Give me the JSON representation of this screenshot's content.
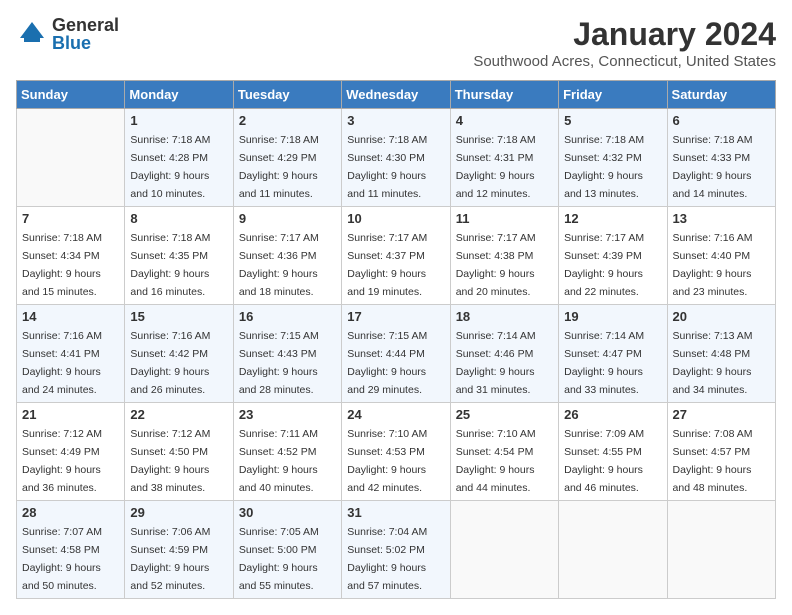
{
  "logo": {
    "general": "General",
    "blue": "Blue"
  },
  "header": {
    "title": "January 2024",
    "subtitle": "Southwood Acres, Connecticut, United States"
  },
  "weekdays": [
    "Sunday",
    "Monday",
    "Tuesday",
    "Wednesday",
    "Thursday",
    "Friday",
    "Saturday"
  ],
  "weeks": [
    [
      {
        "day": "",
        "sunrise": "",
        "sunset": "",
        "daylight": ""
      },
      {
        "day": "1",
        "sunrise": "Sunrise: 7:18 AM",
        "sunset": "Sunset: 4:28 PM",
        "daylight": "Daylight: 9 hours and 10 minutes."
      },
      {
        "day": "2",
        "sunrise": "Sunrise: 7:18 AM",
        "sunset": "Sunset: 4:29 PM",
        "daylight": "Daylight: 9 hours and 11 minutes."
      },
      {
        "day": "3",
        "sunrise": "Sunrise: 7:18 AM",
        "sunset": "Sunset: 4:30 PM",
        "daylight": "Daylight: 9 hours and 11 minutes."
      },
      {
        "day": "4",
        "sunrise": "Sunrise: 7:18 AM",
        "sunset": "Sunset: 4:31 PM",
        "daylight": "Daylight: 9 hours and 12 minutes."
      },
      {
        "day": "5",
        "sunrise": "Sunrise: 7:18 AM",
        "sunset": "Sunset: 4:32 PM",
        "daylight": "Daylight: 9 hours and 13 minutes."
      },
      {
        "day": "6",
        "sunrise": "Sunrise: 7:18 AM",
        "sunset": "Sunset: 4:33 PM",
        "daylight": "Daylight: 9 hours and 14 minutes."
      }
    ],
    [
      {
        "day": "7",
        "sunrise": "Sunrise: 7:18 AM",
        "sunset": "Sunset: 4:34 PM",
        "daylight": "Daylight: 9 hours and 15 minutes."
      },
      {
        "day": "8",
        "sunrise": "Sunrise: 7:18 AM",
        "sunset": "Sunset: 4:35 PM",
        "daylight": "Daylight: 9 hours and 16 minutes."
      },
      {
        "day": "9",
        "sunrise": "Sunrise: 7:17 AM",
        "sunset": "Sunset: 4:36 PM",
        "daylight": "Daylight: 9 hours and 18 minutes."
      },
      {
        "day": "10",
        "sunrise": "Sunrise: 7:17 AM",
        "sunset": "Sunset: 4:37 PM",
        "daylight": "Daylight: 9 hours and 19 minutes."
      },
      {
        "day": "11",
        "sunrise": "Sunrise: 7:17 AM",
        "sunset": "Sunset: 4:38 PM",
        "daylight": "Daylight: 9 hours and 20 minutes."
      },
      {
        "day": "12",
        "sunrise": "Sunrise: 7:17 AM",
        "sunset": "Sunset: 4:39 PM",
        "daylight": "Daylight: 9 hours and 22 minutes."
      },
      {
        "day": "13",
        "sunrise": "Sunrise: 7:16 AM",
        "sunset": "Sunset: 4:40 PM",
        "daylight": "Daylight: 9 hours and 23 minutes."
      }
    ],
    [
      {
        "day": "14",
        "sunrise": "Sunrise: 7:16 AM",
        "sunset": "Sunset: 4:41 PM",
        "daylight": "Daylight: 9 hours and 24 minutes."
      },
      {
        "day": "15",
        "sunrise": "Sunrise: 7:16 AM",
        "sunset": "Sunset: 4:42 PM",
        "daylight": "Daylight: 9 hours and 26 minutes."
      },
      {
        "day": "16",
        "sunrise": "Sunrise: 7:15 AM",
        "sunset": "Sunset: 4:43 PM",
        "daylight": "Daylight: 9 hours and 28 minutes."
      },
      {
        "day": "17",
        "sunrise": "Sunrise: 7:15 AM",
        "sunset": "Sunset: 4:44 PM",
        "daylight": "Daylight: 9 hours and 29 minutes."
      },
      {
        "day": "18",
        "sunrise": "Sunrise: 7:14 AM",
        "sunset": "Sunset: 4:46 PM",
        "daylight": "Daylight: 9 hours and 31 minutes."
      },
      {
        "day": "19",
        "sunrise": "Sunrise: 7:14 AM",
        "sunset": "Sunset: 4:47 PM",
        "daylight": "Daylight: 9 hours and 33 minutes."
      },
      {
        "day": "20",
        "sunrise": "Sunrise: 7:13 AM",
        "sunset": "Sunset: 4:48 PM",
        "daylight": "Daylight: 9 hours and 34 minutes."
      }
    ],
    [
      {
        "day": "21",
        "sunrise": "Sunrise: 7:12 AM",
        "sunset": "Sunset: 4:49 PM",
        "daylight": "Daylight: 9 hours and 36 minutes."
      },
      {
        "day": "22",
        "sunrise": "Sunrise: 7:12 AM",
        "sunset": "Sunset: 4:50 PM",
        "daylight": "Daylight: 9 hours and 38 minutes."
      },
      {
        "day": "23",
        "sunrise": "Sunrise: 7:11 AM",
        "sunset": "Sunset: 4:52 PM",
        "daylight": "Daylight: 9 hours and 40 minutes."
      },
      {
        "day": "24",
        "sunrise": "Sunrise: 7:10 AM",
        "sunset": "Sunset: 4:53 PM",
        "daylight": "Daylight: 9 hours and 42 minutes."
      },
      {
        "day": "25",
        "sunrise": "Sunrise: 7:10 AM",
        "sunset": "Sunset: 4:54 PM",
        "daylight": "Daylight: 9 hours and 44 minutes."
      },
      {
        "day": "26",
        "sunrise": "Sunrise: 7:09 AM",
        "sunset": "Sunset: 4:55 PM",
        "daylight": "Daylight: 9 hours and 46 minutes."
      },
      {
        "day": "27",
        "sunrise": "Sunrise: 7:08 AM",
        "sunset": "Sunset: 4:57 PM",
        "daylight": "Daylight: 9 hours and 48 minutes."
      }
    ],
    [
      {
        "day": "28",
        "sunrise": "Sunrise: 7:07 AM",
        "sunset": "Sunset: 4:58 PM",
        "daylight": "Daylight: 9 hours and 50 minutes."
      },
      {
        "day": "29",
        "sunrise": "Sunrise: 7:06 AM",
        "sunset": "Sunset: 4:59 PM",
        "daylight": "Daylight: 9 hours and 52 minutes."
      },
      {
        "day": "30",
        "sunrise": "Sunrise: 7:05 AM",
        "sunset": "Sunset: 5:00 PM",
        "daylight": "Daylight: 9 hours and 55 minutes."
      },
      {
        "day": "31",
        "sunrise": "Sunrise: 7:04 AM",
        "sunset": "Sunset: 5:02 PM",
        "daylight": "Daylight: 9 hours and 57 minutes."
      },
      {
        "day": "",
        "sunrise": "",
        "sunset": "",
        "daylight": ""
      },
      {
        "day": "",
        "sunrise": "",
        "sunset": "",
        "daylight": ""
      },
      {
        "day": "",
        "sunrise": "",
        "sunset": "",
        "daylight": ""
      }
    ]
  ]
}
